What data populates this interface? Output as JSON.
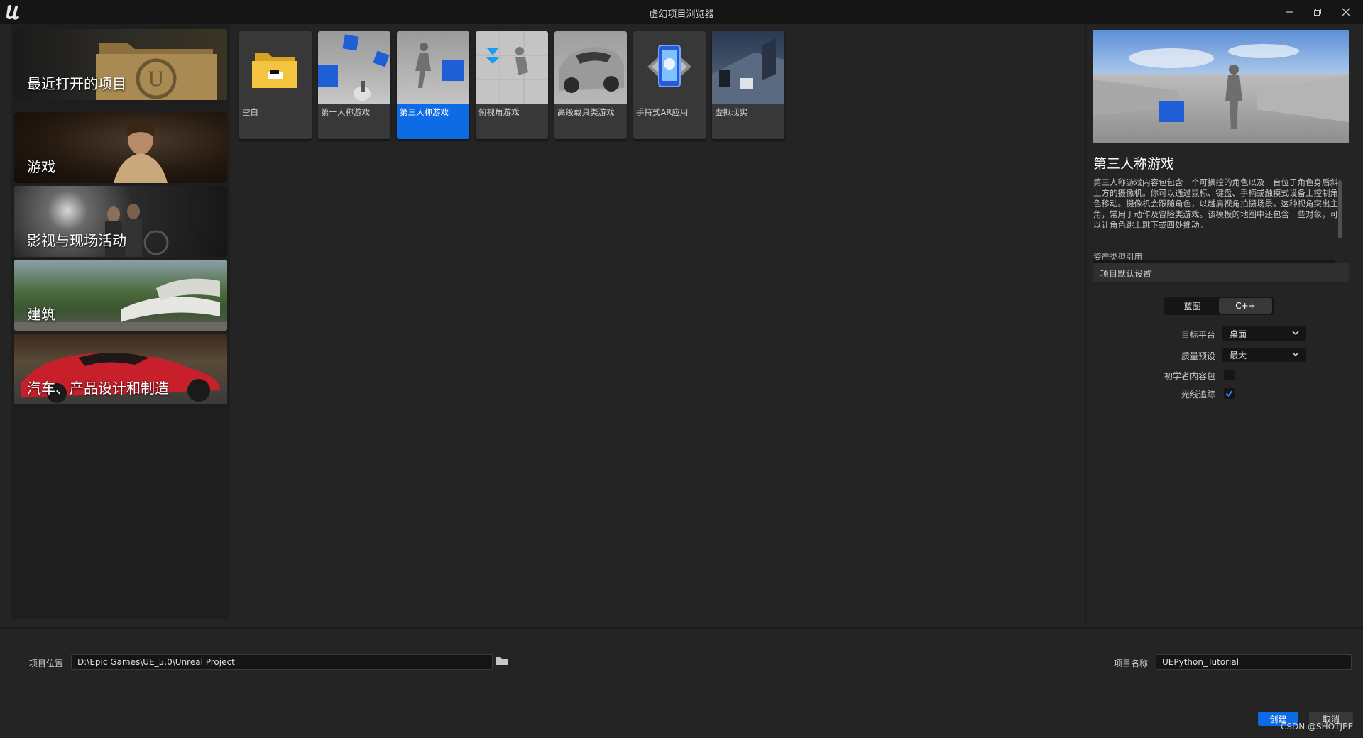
{
  "window": {
    "title": "虚幻项目浏览器",
    "logo_icon": "unreal-logo-icon",
    "controls": [
      "minimize-icon",
      "restore-icon",
      "close-icon"
    ]
  },
  "categories": [
    {
      "label": "最近打开的项目",
      "selected": false
    },
    {
      "label": "游戏",
      "selected": true
    },
    {
      "label": "影视与现场活动",
      "selected": false
    },
    {
      "label": "建筑",
      "selected": false
    },
    {
      "label": "汽车、产品设计和制造",
      "selected": false
    }
  ],
  "templates": [
    {
      "label": "空白",
      "selected": false
    },
    {
      "label": "第一人称游戏",
      "selected": false
    },
    {
      "label": "第三人称游戏",
      "selected": true
    },
    {
      "label": "俯视角游戏",
      "selected": false
    },
    {
      "label": "高级载具类游戏",
      "selected": false
    },
    {
      "label": "手持式AR应用",
      "selected": false
    },
    {
      "label": "虚拟现实",
      "selected": false
    }
  ],
  "details": {
    "title": "第三人称游戏",
    "description": "第三人称游戏内容包包含一个可操控的角色以及一台位于角色身后斜上方的摄像机。你可以通过鼠标、键盘、手柄或触摸式设备上控制角色移动。摄像机会跟随角色，以越肩视角拍摄场景。这种视角突出主角，常用于动作及冒险类游戏。该模板的地图中还包含一些对象，可以让角色跳上跳下或四处推动。",
    "asset_ref_label": "资产类型引用",
    "defaults_header": "项目默认设置"
  },
  "settings": {
    "language_options": [
      "蓝图",
      "C++"
    ],
    "language_selected": "C++",
    "target_platform_label": "目标平台",
    "target_platform_value": "桌面",
    "quality_label": "质量预设",
    "quality_value": "最大",
    "starter_content_label": "初学者内容包",
    "starter_content_checked": false,
    "raytracing_label": "光线追踪",
    "raytracing_checked": true
  },
  "bottom": {
    "location_label": "项目位置",
    "location_value": "D:\\Epic Games\\UE_5.0\\Unreal Project",
    "name_label": "项目名称",
    "name_value": "UEPython_Tutorial",
    "create_label": "创建",
    "cancel_label": "取消",
    "watermark": "CSDN @SHOTJEE"
  },
  "colors": {
    "accent": "#0e6be6",
    "background": "#242424",
    "titlebar": "#151515"
  }
}
